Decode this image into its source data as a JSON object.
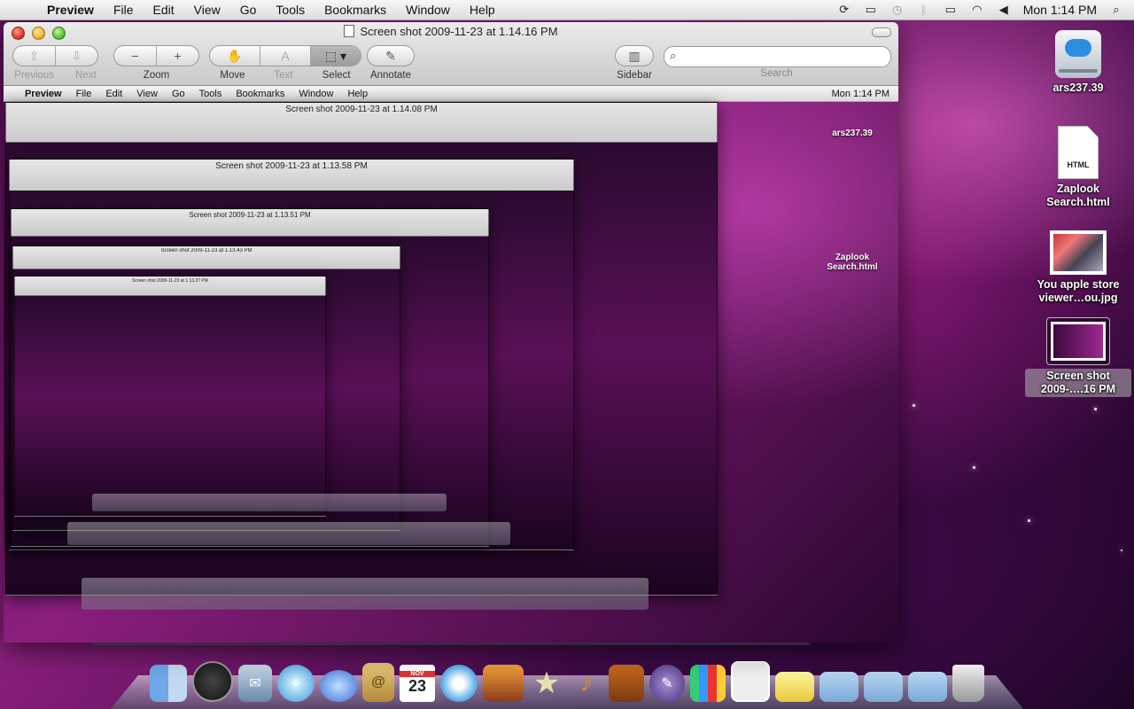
{
  "menubar": {
    "app": "Preview",
    "items": [
      "File",
      "Edit",
      "View",
      "Go",
      "Tools",
      "Bookmarks",
      "Window",
      "Help"
    ],
    "clock": "Mon 1:14 PM"
  },
  "window": {
    "title": "Screen shot 2009-11-23 at 1.14.16 PM",
    "toolbar": {
      "previous": "Previous",
      "next": "Next",
      "zoom": "Zoom",
      "move": "Move",
      "text": "Text",
      "select": "Select",
      "annotate": "Annotate",
      "sidebar": "Sidebar",
      "search_label": "Search"
    },
    "nested_titles": [
      "Screen shot 2009-11-23 at 1.14.08 PM",
      "Screen shot 2009-11-23 at 1.13.58 PM",
      "Screen shot 2009-11-23 at 1.13.51 PM",
      "Screen shot 2009-11-23 at 1.13.43 PM",
      "Screen shot 2009-11-23 at 1.13.37 PM"
    ],
    "nested_menubar_clock": "Mon 1:14 PM"
  },
  "desktop": {
    "icons": [
      {
        "label": "ars237.39"
      },
      {
        "label": "Zaplook Search.html",
        "badge": "HTML"
      },
      {
        "label": "You apple store viewer…ou.jpg"
      },
      {
        "label": "Screen shot 2009-….16 PM"
      }
    ]
  },
  "dock": {
    "items": [
      "finder",
      "dashboard",
      "mail",
      "safari",
      "ichat",
      "address-book",
      "ical",
      "itunes",
      "iphoto",
      "imovie",
      "garageband",
      "keynote",
      "pages",
      "numbers",
      "preview",
      "downloads",
      "applications",
      "documents",
      "folder",
      "trash"
    ],
    "ical_day": "23",
    "ical_month": "NOV"
  }
}
